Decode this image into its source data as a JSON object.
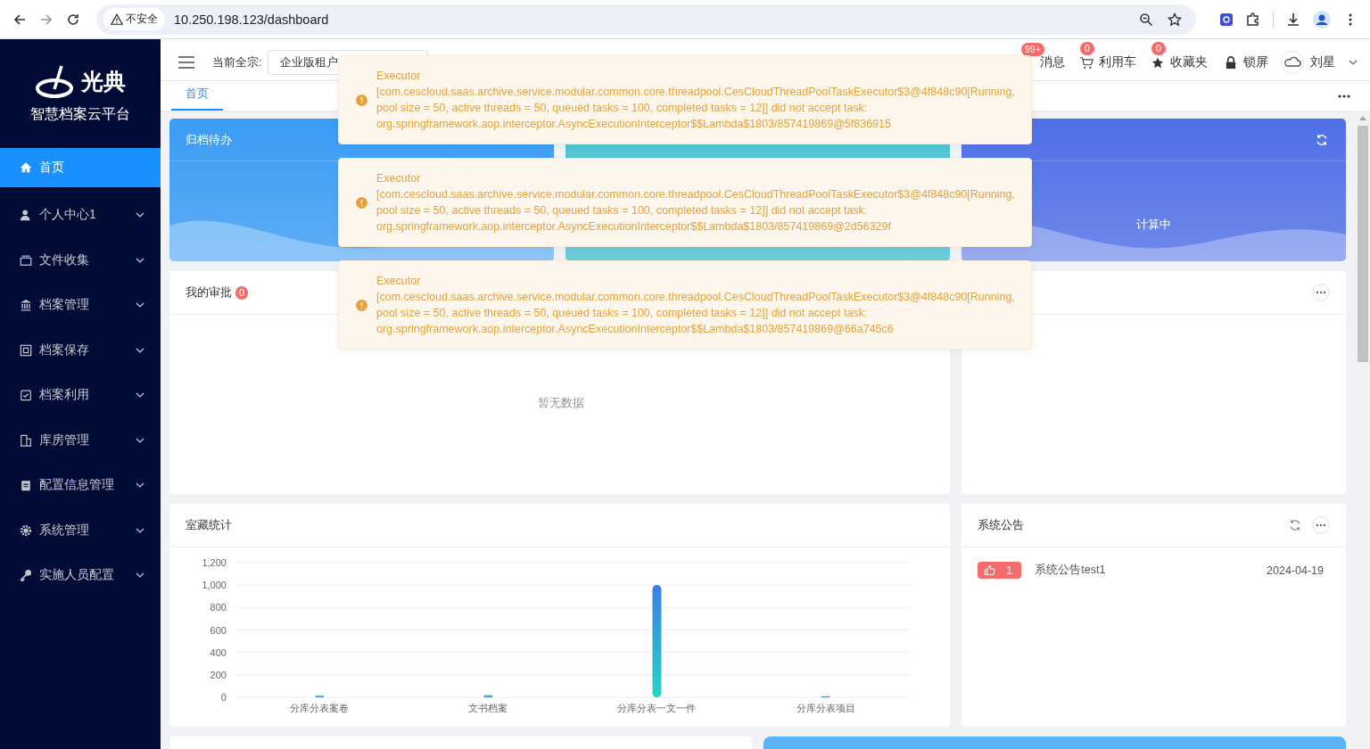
{
  "browser": {
    "security_label": "不安全",
    "url": "10.250.198.123/dashboard"
  },
  "sidebar": {
    "logo_text": "光典",
    "platform_name": "智慧档案云平台",
    "items": [
      {
        "label": "首页",
        "selected": true,
        "expandable": false
      },
      {
        "label": "个人中心1",
        "selected": false,
        "expandable": true
      },
      {
        "label": "文件收集",
        "selected": false,
        "expandable": true
      },
      {
        "label": "档案管理",
        "selected": false,
        "expandable": true
      },
      {
        "label": "档案保存",
        "selected": false,
        "expandable": true
      },
      {
        "label": "档案利用",
        "selected": false,
        "expandable": true
      },
      {
        "label": "库房管理",
        "selected": false,
        "expandable": true
      },
      {
        "label": "配置信息管理",
        "selected": false,
        "expandable": true
      },
      {
        "label": "系统管理",
        "selected": false,
        "expandable": true
      },
      {
        "label": "实施人员配置",
        "selected": false,
        "expandable": true
      }
    ]
  },
  "header": {
    "fonds_label": "当前全宗:",
    "fonds_value": "企业版租户",
    "messages": {
      "label": "消息",
      "badge": "99+"
    },
    "cart": {
      "label": "利用车",
      "badge": "0"
    },
    "favorites": {
      "label": "收藏夹",
      "badge": "0"
    },
    "lock": {
      "label": "锁屏"
    },
    "user": {
      "name": "刘星"
    }
  },
  "tabs": [
    {
      "label": "首页",
      "selected": true
    }
  ],
  "stat_cards": [
    {
      "title": "归档待办",
      "color": "#3a9cf5"
    },
    {
      "color": "#4cc3d4"
    },
    {
      "value": "计算中",
      "color": "#4e6fe8"
    }
  ],
  "approval_panel": {
    "title": "我的审批",
    "count": "0",
    "empty_text": "暂无数据"
  },
  "collection_panel": {
    "title": "室藏统计",
    "chart_data": {
      "type": "bar",
      "categories": [
        "分库分表案卷",
        "文书档案",
        "分库分表一文一件",
        "分库分表项目"
      ],
      "values": [
        15,
        20,
        1000,
        12
      ],
      "grid": true,
      "ylim": [
        0,
        1200
      ],
      "yticks": [
        0,
        200,
        400,
        600,
        800,
        {
          "value": 1000,
          "label": "1,000"
        },
        {
          "value": 1200,
          "label": "1,200"
        }
      ]
    }
  },
  "notice_panel": {
    "title": "系统公告",
    "items": [
      {
        "likes": "1",
        "title": "系统公告test1",
        "date": "2024-04-19"
      }
    ]
  },
  "toasts": [
    {
      "title": "Executor",
      "message": "[com.cescloud.saas.archive.service.modular.common.core.threadpool.CesCloudThreadPoolTaskExecutor$3@4f848c90[Running, pool size = 50, active threads = 50, queued tasks = 100, completed tasks = 12]] did not accept task: org.springframework.aop.interceptor.AsyncExecutionInterceptor$$Lambda$1803/857419869@5f836915"
    },
    {
      "title": "Executor",
      "message": "[com.cescloud.saas.archive.service.modular.common.core.threadpool.CesCloudThreadPoolTaskExecutor$3@4f848c90[Running, pool size = 50, active threads = 50, queued tasks = 100, completed tasks = 12]] did not accept task: org.springframework.aop.interceptor.AsyncExecutionInterceptor$$Lambda$1803/857419869@2d56329f"
    },
    {
      "title": "Executor",
      "message": "[com.cescloud.saas.archive.service.modular.common.core.threadpool.CesCloudThreadPoolTaskExecutor$3@4f848c90[Running, pool size = 50, active threads = 50, queued tasks = 100, completed tasks = 12]] did not accept task: org.springframework.aop.interceptor.AsyncExecutionInterceptor$$Lambda$1803/857419869@66a745c6"
    }
  ]
}
